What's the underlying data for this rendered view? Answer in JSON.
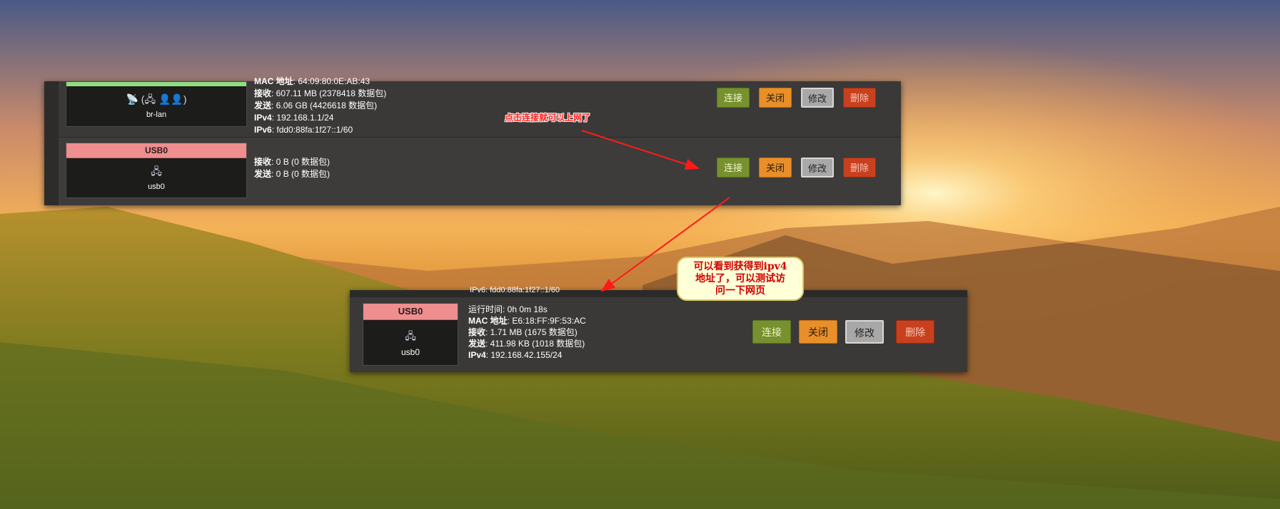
{
  "panel1": {
    "rows": [
      {
        "iface_name": "br-lan",
        "iface_icon": "📡 (🖧 👤👤)",
        "lines": [
          {
            "k": "MAC 地址",
            "v": ": 64:09:80:0E:AB:43"
          },
          {
            "k": "接收",
            "v": ": 607.11 MB (2378418 数据包)"
          },
          {
            "k": "发送",
            "v": ": 6.06 GB (4426618 数据包)"
          },
          {
            "k": "IPv4",
            "v": ": 192.168.1.1/24"
          },
          {
            "k": "IPv6",
            "v": ": fdd0:88fa:1f27::1/60"
          }
        ]
      },
      {
        "header": "USB0",
        "iface_name": "usb0",
        "iface_icon": "🖧",
        "lines": [
          {
            "k": "接收",
            "v": ": 0 B (0 数据包)"
          },
          {
            "k": "发送",
            "v": ": 0 B (0 数据包)"
          }
        ]
      }
    ]
  },
  "panel2": {
    "header": "USB0",
    "iface_name": "usb0",
    "iface_icon": "🖧",
    "clipped_line": "IPv6: fdd0:88fa:1f27::1/60",
    "lines": [
      {
        "k": "运行时间",
        "v": ": 0h 0m 18s"
      },
      {
        "k": "MAC 地址",
        "v": ": E6:18:FF:9F:53:AC"
      },
      {
        "k": "接收",
        "v": ": 1.71 MB (1675 数据包)"
      },
      {
        "k": "发送",
        "v": ": 411.98 KB (1018 数据包)"
      },
      {
        "k": "IPv4",
        "v": ": 192.168.42.155/24"
      }
    ]
  },
  "buttons": {
    "connect": "连接",
    "close": "关闭",
    "edit": "修改",
    "delete": "删除"
  },
  "annotations": {
    "note1": "点击连接就可以上网了",
    "bubble_lines": [
      "可以看到获得到ipv4",
      "地址了，可以测试访",
      "问一下网页"
    ],
    "arrow_color": "#ff1a1a"
  },
  "colors": {
    "link_up": "#8fde7f",
    "link_down": "#ee8e8f",
    "connect": "#76912e",
    "close": "#e88f2a",
    "edit": "#a8a8a8",
    "delete": "#c8401e"
  }
}
